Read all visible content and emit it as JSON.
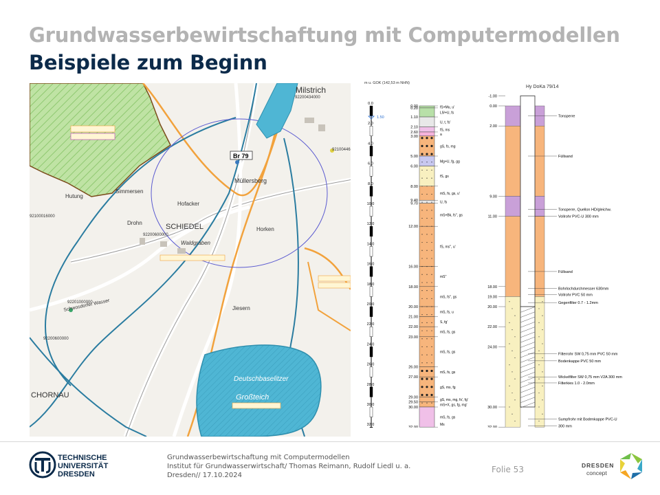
{
  "slide": {
    "title": "Grundwasserbewirtschaftung mit Computermodellen",
    "subtitle": "Beispiele zum Beginn",
    "page_label": "Folie 53"
  },
  "footer": {
    "lines": [
      "Grundwasserbewirtschaftung mit Computermodellen",
      "Institut für Grundwasserwirtschaft/ Thomas Reimann, Rudolf Liedl u. a.",
      "Dresden// 17.10.2024"
    ],
    "logo_left": [
      "TECHNISCHE",
      "UNIVERSITÄT",
      "DRESDEN"
    ],
    "logo_right": [
      "DRESDEN",
      "concept"
    ]
  },
  "map": {
    "labels": {
      "milstrich": "Milstrich",
      "br79": "Br 79",
      "muellersberg": "Müllersberg",
      "hofacker": "Hofacker",
      "simmersen": "Simmersen",
      "hutung": "Hutung",
      "drohn": "Drohn",
      "schiedel": "SCHIEDEL",
      "waldgraben": "Waldgraben",
      "horken": "Horken",
      "jiesern": "Jiesern",
      "chornau": "CHORNAU",
      "schwosdorfer": "Schwosdorfer Wasser",
      "deutschbaselitzer": "Deutschbaselitzer",
      "grossteich": "Großteich",
      "well1": "92200600000",
      "well2": "92201000000",
      "well3": "92200600000",
      "well4": "92100446000",
      "well5": "92100016000",
      "well6": "92200434000"
    }
  },
  "log": {
    "left_header": "m u. GOK (142,53 m NHN)",
    "right_header": "Hy DoKa 79/14",
    "scale": [
      "0.0",
      "2.0",
      "4.0",
      "6.0",
      "8.0",
      "10.0",
      "12.0",
      "14.0",
      "16.0",
      "18.0",
      "20.0",
      "22.0",
      "24.0",
      "26.0",
      "28.0",
      "30.0",
      "32.0"
    ],
    "water_level": "1.50",
    "water_level2": "1.10",
    "depths": [
      "0.00",
      "0.20",
      "1.10",
      "2.10",
      "2.60",
      "3.00",
      "5.00",
      "6.00",
      "8.00",
      "9.40",
      "9.70",
      "12.00",
      "16.00",
      "18.00",
      "20.00",
      "21.00",
      "22.00",
      "23.00",
      "26.00",
      "27.00",
      "29.00",
      "29.50",
      "30.00",
      "32.00"
    ],
    "litho": [
      "fS+Mu, u'",
      "L9/+U, fs",
      "U, t, fs'",
      "fS, ms",
      "a",
      "gS, fs, mg",
      "Mg+U, fg, gg",
      "fS, gs",
      "mS, fs, gs, u'",
      "U, fs",
      "mS+Bk, fs'', gs",
      "fS, ms'', u'",
      "mS''",
      "mS, fs'', gs",
      "mS, fs, u",
      "S, fg'",
      "mS, fs, gs",
      "mS, fs, gs",
      "mS, fs, gs",
      "gS, ms, fg",
      "gS, ms, mg, fs', fg'",
      "mS+X, gs, fg, mg'",
      "mS, fs, gs",
      "Ms"
    ],
    "well_depths": [
      "-1.00",
      "0.00",
      "2.00",
      "9.00",
      "11.00",
      "18.00",
      "19.00",
      "20.00",
      "22.00",
      "24.00",
      "30.00",
      "32.00"
    ],
    "well_labels": [
      "Tonsperre",
      "Füllsand",
      "Tonsperre, Quellon HD/gleichw.",
      "Vollrohr PVC-U 300 mm",
      "Füllsand",
      "Bohrlochdurchmesser 630mm",
      "Vollrohr PVC 50 mm",
      "Gegenfilter 0.7 - 1.2mm",
      "Filterrohr SW 0,75 mm PVC 50 mm",
      "Bodenkappe PVC 50 mm",
      "Wickelfilter SW 0,75 mm V2A 300 mm",
      "Filterkies 1.0 - 2.0mm",
      "Sumpfrohr mit Bodenkappe PVC-U",
      "300 mm"
    ]
  }
}
